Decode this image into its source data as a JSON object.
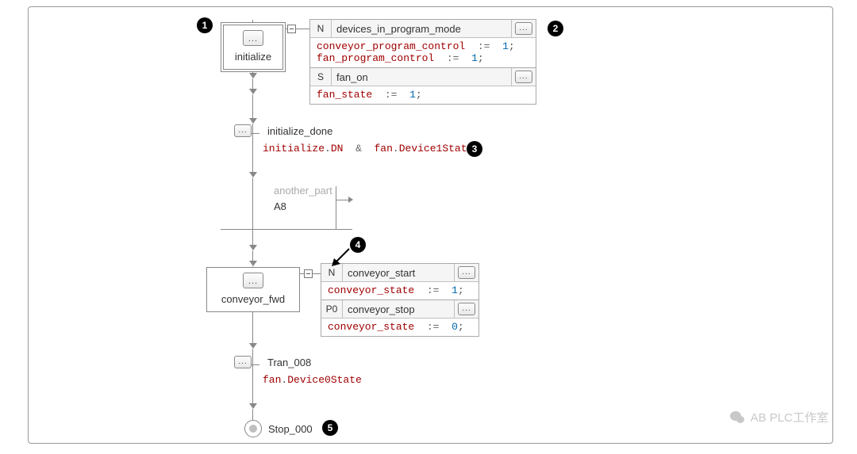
{
  "callouts": {
    "c1": "1",
    "c2": "2",
    "c3": "3",
    "c4": "4",
    "c5": "5"
  },
  "steps": {
    "initialize": {
      "label": "initialize"
    },
    "conveyor_fwd": {
      "label": "conveyor_fwd"
    }
  },
  "actions": {
    "initialize": [
      {
        "q": "N",
        "name": "devices_in_program_mode",
        "body_lines": [
          {
            "var": "conveyor_program_control",
            "op": ":=",
            "val": "1",
            "end": ";"
          },
          {
            "var": "fan_program_control",
            "op": ":=",
            "val": "1",
            "end": ";"
          }
        ]
      },
      {
        "q": "S",
        "name": "fan_on",
        "body_lines": [
          {
            "var": "fan_state",
            "op": ":=",
            "val": "1",
            "end": ";"
          }
        ]
      }
    ],
    "conveyor_fwd": [
      {
        "q": "N",
        "name": "conveyor_start",
        "body_lines": [
          {
            "var": "conveyor_state",
            "op": ":=",
            "val": "1",
            "end": ";"
          }
        ]
      },
      {
        "q": "P0",
        "name": "conveyor_stop",
        "body_lines": [
          {
            "var": "conveyor_state",
            "op": ":=",
            "val": "0",
            "end": ";"
          }
        ]
      }
    ]
  },
  "transitions": {
    "initialize_done": {
      "label": "initialize_done",
      "cond": {
        "left": {
          "obj": "initialize",
          "dot": ".",
          "prop": "DN"
        },
        "amp": "&",
        "right": {
          "obj": "fan",
          "dot": ".",
          "prop": "Device1State"
        }
      }
    },
    "tran_008": {
      "label": "Tran_008",
      "cond_simple": {
        "obj": "fan",
        "dot": ".",
        "prop": "Device0State"
      }
    }
  },
  "branch": {
    "name": "another_part",
    "ref": "A8"
  },
  "stop": {
    "label": "Stop_000"
  },
  "watermark": "AB PLC工作室"
}
